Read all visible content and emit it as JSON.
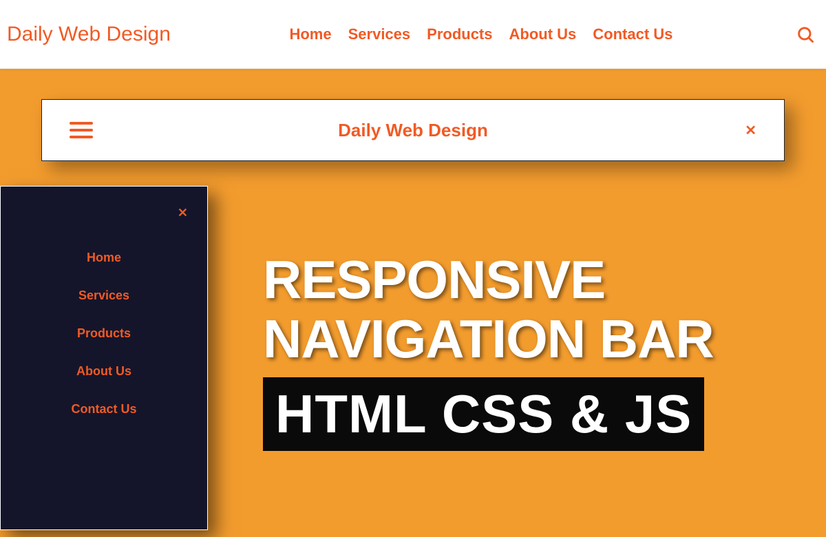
{
  "colors": {
    "accent": "#f15a24",
    "background": "#f39c2e",
    "dark_panel": "#14152b",
    "black_box": "#0a0a0a"
  },
  "topbar": {
    "brand": "Daily Web Design",
    "nav": [
      "Home",
      "Services",
      "Products",
      "About Us",
      "Contact Us"
    ]
  },
  "card": {
    "title": "Daily Web Design",
    "close_symbol": "✕"
  },
  "side_panel": {
    "close_symbol": "✕",
    "items": [
      "Home",
      "Services",
      "Products",
      "About Us",
      "Contact Us"
    ]
  },
  "hero": {
    "line1": "RESPONSIVE",
    "line2": "NAVIGATION BAR",
    "box": "HTML CSS & JS"
  }
}
